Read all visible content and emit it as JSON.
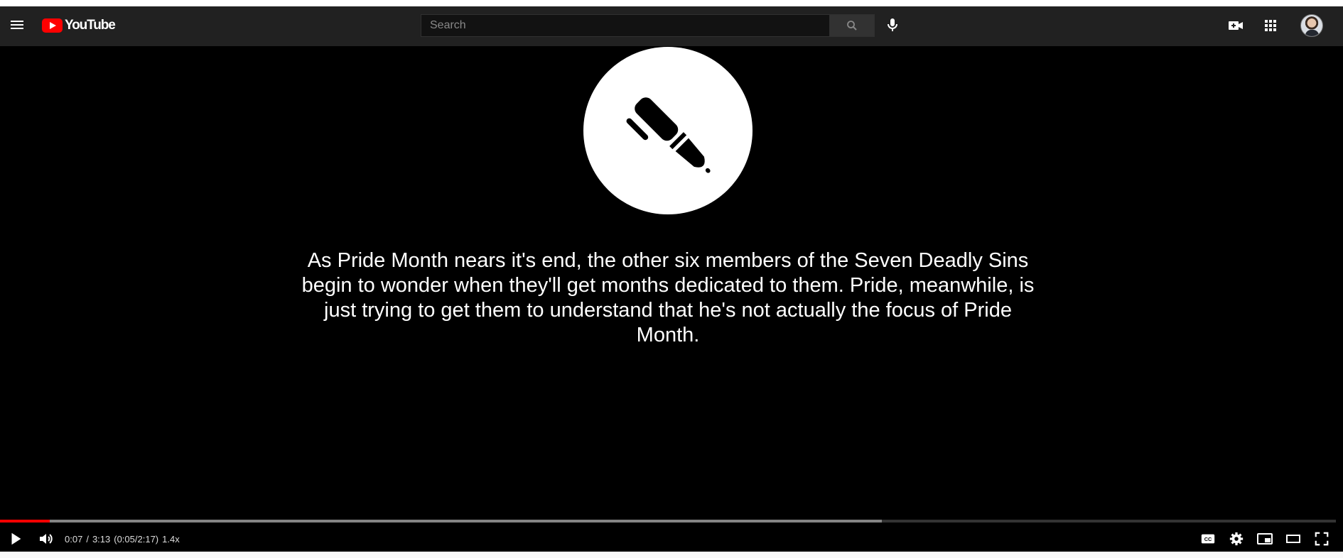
{
  "masthead": {
    "logo_text": "YouTube",
    "search_placeholder": "Search",
    "icons": [
      "hamburger-menu-icon",
      "search-icon",
      "microphone-icon",
      "create-video-icon",
      "apps-grid-icon",
      "avatar"
    ]
  },
  "video": {
    "caption": "As Pride Month nears it's end, the other six members of the Seven Deadly Sins begin to wonder when they'll get months dedicated to them. Pride, meanwhile, is just trying to get them to understand that he's not actually the focus of Pride Month.",
    "emblem_icon": "pen-icon"
  },
  "player": {
    "time_current": "0:07",
    "time_separator": "/",
    "time_total": "3:13",
    "time_adjusted": "(0:05/2:17)",
    "speed": "1.4x",
    "progress_played_fraction": 0.037,
    "progress_loaded_fraction": 0.66,
    "accent_color": "#ff0000",
    "controls_left": [
      "play-icon",
      "volume-icon"
    ],
    "controls_right": [
      "captions-icon",
      "settings-icon",
      "miniplayer-icon",
      "theater-mode-icon",
      "fullscreen-icon"
    ]
  }
}
